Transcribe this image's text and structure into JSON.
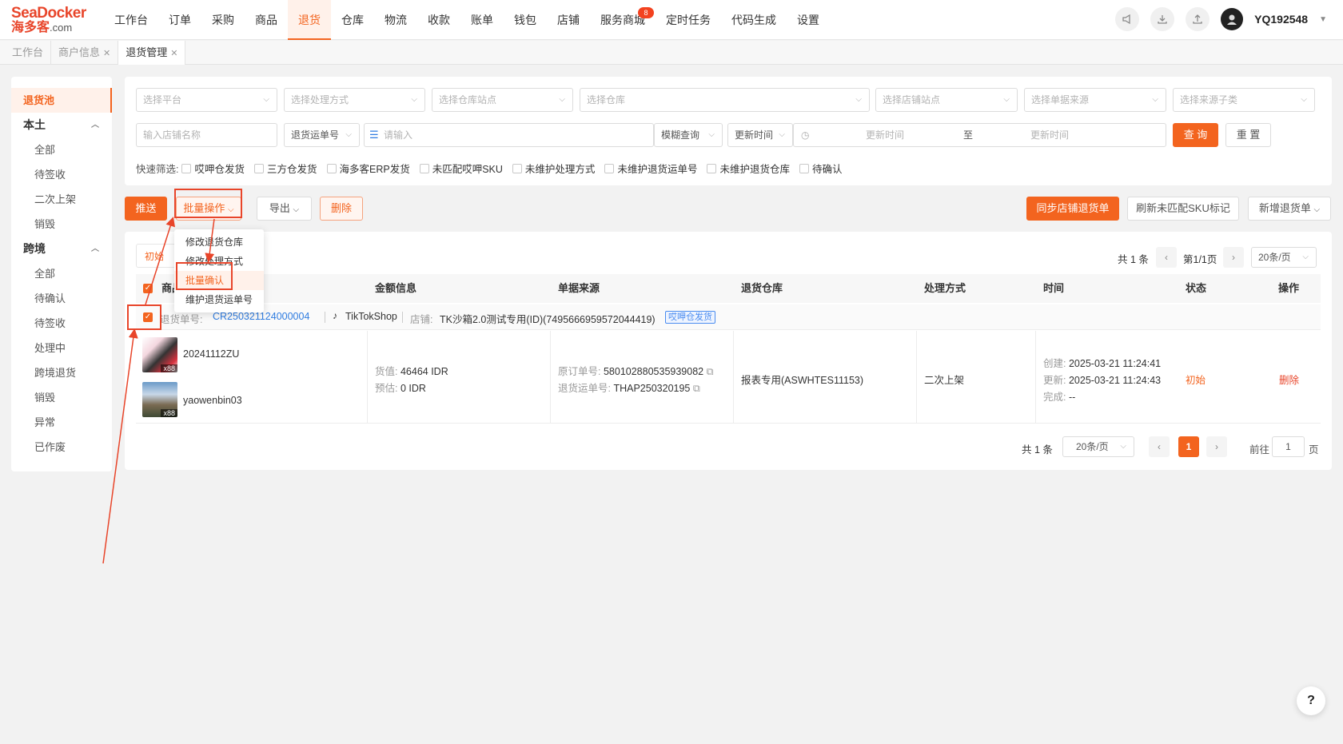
{
  "logo": {
    "brand_en": "SeaDocker",
    "brand_cn": "海多客",
    "brand_suffix": ".com"
  },
  "nav": {
    "items": [
      "工作台",
      "订单",
      "采购",
      "商品",
      "退货",
      "仓库",
      "物流",
      "收款",
      "账单",
      "钱包",
      "店铺",
      "服务商城",
      "定时任务",
      "代码生成",
      "设置"
    ],
    "active": "退货",
    "badge": "8"
  },
  "user": {
    "name": "YQ192548"
  },
  "tabs": [
    {
      "label": "工作台"
    },
    {
      "label": "商户信息"
    },
    {
      "label": "退货管理"
    }
  ],
  "sidebar": {
    "pool": "退货池",
    "groups": [
      {
        "label": "本土",
        "items": [
          "全部",
          "待签收",
          "二次上架",
          "销毁"
        ]
      },
      {
        "label": "跨境",
        "items": [
          "全部",
          "待确认",
          "待签收",
          "处理中",
          "跨境退货",
          "销毁",
          "异常",
          "已作废"
        ]
      }
    ]
  },
  "filters": {
    "row1": [
      "选择平台",
      "选择处理方式",
      "选择仓库站点",
      "选择仓库",
      "选择店铺站点",
      "选择单据来源",
      "选择来源子类"
    ],
    "shop_name_ph": "输入店铺名称",
    "waybill_type": "退货运单号",
    "input_ph": "请输入",
    "fuzzy": "模糊查询",
    "time_type": "更新时间",
    "time_start_ph": "更新时间",
    "time_sep": "至",
    "time_end_ph": "更新时间",
    "query": "查 询",
    "reset": "重 置",
    "quick_label": "快速筛选:",
    "quick": [
      "哎呷仓发货",
      "三方仓发货",
      "海多客ERP发货",
      "未匹配哎呷SKU",
      "未维护处理方式",
      "未维护退货运单号",
      "未维护退货仓库",
      "待确认"
    ]
  },
  "actions": {
    "push": "推送",
    "batch": "批量操作",
    "export": "导出",
    "delete": "删除",
    "sync": "同步店铺退货单",
    "refresh": "刷新未匹配SKU标记",
    "add": "新增退货单"
  },
  "dropdown": [
    "修改退货仓库",
    "修改处理方式",
    "批量确认",
    "维护退货运单号"
  ],
  "status_tab": "初始",
  "pager_top": {
    "total": "共 1 条",
    "page": "第1/1页",
    "size": "20条/页"
  },
  "table": {
    "headers": [
      "商品",
      "金额信息",
      "单据来源",
      "退货仓库",
      "处理方式",
      "时间",
      "状态",
      "操作"
    ],
    "order": {
      "no_label": "退货单号:",
      "no": "CR250321124000004",
      "platform": "TikTokShop",
      "shop_label": "店铺:",
      "shop": "TK沙箱2.0测试专用(ID)(7495666959572044419)",
      "tag": "哎呷仓发货"
    },
    "row": {
      "products": [
        {
          "sku": "20241112ZU",
          "qty": "x88"
        },
        {
          "sku": "yaowenbin03",
          "qty": "x88"
        }
      ],
      "amount": {
        "goods_label": "货值:",
        "goods": "46464 IDR",
        "est_label": "预估:",
        "est": "0 IDR"
      },
      "source": {
        "orig_label": "原订单号:",
        "orig": "580102880535939082",
        "ret_label": "退货运单号:",
        "ret": "THAP250320195"
      },
      "warehouse": "报表专用(ASWHTES11153)",
      "method": "二次上架",
      "time": {
        "created_label": "创建:",
        "created": "2025-03-21 11:24:41",
        "updated_label": "更新:",
        "updated": "2025-03-21 11:24:43",
        "done_label": "完成:",
        "done": "--"
      },
      "status": "初始",
      "op": "删除"
    }
  },
  "pager_bottom": {
    "total": "共 1 条",
    "size": "20条/页",
    "current": "1",
    "goto_label": "前往",
    "goto_value": "1",
    "goto_unit": "页"
  },
  "help": "?",
  "colors": {
    "accent": "#f3641f",
    "annotation": "#e8452a",
    "link": "#2f7ce0"
  }
}
